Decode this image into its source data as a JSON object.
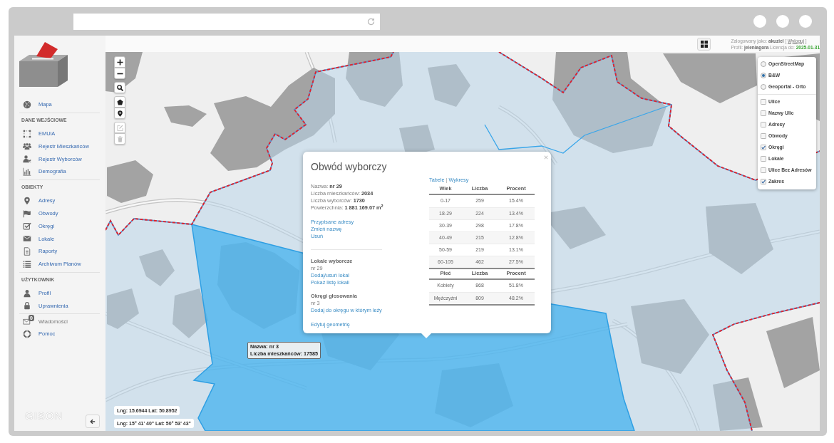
{
  "sidebar": {
    "sections": [
      {
        "items": [
          {
            "label": "Mapa",
            "disabled": false
          }
        ]
      },
      {
        "heading": "DANE WEJŚCIOWE",
        "items": [
          {
            "label": "EMUiA",
            "disabled": false
          },
          {
            "label": "Rejestr Mieszkańców",
            "disabled": false
          },
          {
            "label": "Rejestr Wyborców",
            "disabled": false
          },
          {
            "label": "Demografia",
            "disabled": false
          }
        ]
      },
      {
        "heading": "OBIEKTY",
        "items": [
          {
            "label": "Adresy",
            "disabled": false
          },
          {
            "label": "Obwody",
            "disabled": false
          },
          {
            "label": "Okręgi",
            "disabled": false
          },
          {
            "label": "Lokale",
            "disabled": false
          },
          {
            "label": "Raporty",
            "disabled": false
          },
          {
            "label": "Archiwum Planów",
            "disabled": false
          }
        ]
      },
      {
        "heading": "UŻYTKOWNIK",
        "items": [
          {
            "label": "Profil",
            "disabled": false
          },
          {
            "label": "Uprawnienia",
            "disabled": false
          }
        ]
      },
      {
        "items": [
          {
            "label": "Wiadomości",
            "disabled": true,
            "badge": "0"
          },
          {
            "label": "Pomoc",
            "disabled": false
          }
        ]
      }
    ],
    "logo": "GISON"
  },
  "header": {
    "user_line": "Zalogowany jako: **akuziel** [",
    "logout": "Wyloguj",
    "user_line_end": "]",
    "profile_line": "Profil: **jeleniagora** Licencja do:",
    "license_date": "2025-01-31"
  },
  "map": {
    "tool_groups": [
      {
        "tools": [
          {
            "disabled": false
          },
          {
            "disabled": false
          }
        ]
      },
      {
        "tools": [
          {
            "disabled": false
          }
        ]
      },
      {
        "tools": [
          {
            "disabled": false
          },
          {
            "disabled": false
          }
        ]
      },
      {
        "tools": [
          {
            "disabled": true
          },
          {
            "disabled": true
          }
        ]
      }
    ],
    "layers": {
      "base": [
        {
          "label": "OpenStreetMap",
          "selected": false
        },
        {
          "label": "B&W",
          "selected": true
        },
        {
          "label": "Geoportal - Orto",
          "selected": false
        }
      ],
      "overlays": [
        {
          "label": "Ulice",
          "checked": false
        },
        {
          "label": "Nazwy Ulic",
          "checked": false
        },
        {
          "label": "Adresy",
          "checked": false
        },
        {
          "label": "Obwody",
          "checked": false
        },
        {
          "label": "Okręgi",
          "checked": true
        },
        {
          "label": "Lokale",
          "checked": false
        },
        {
          "label": "Ulice Bez Adresów",
          "checked": false
        },
        {
          "label": "Zakres",
          "checked": true
        }
      ]
    },
    "popup": {
      "title": "Obwód wyborczy",
      "details": [
        "Nazwa: **nr 29**",
        "Liczba mieszkańców: **2034**",
        "Liczba wyborców: **1730**",
        "Powierzchnia: **1 881 169.07 m**$^{2}$"
      ],
      "actions": [
        "Przypisane adresy",
        "Zmień nazwę",
        "Usuń"
      ],
      "sections": [
        {
          "heading": "Lokale wyborcze",
          "value": "nr 29",
          "links": [
            "Dodaj/usuń lokal",
            "Pokaż listę lokali"
          ]
        },
        {
          "heading": "Okręgi głosowania",
          "value": "nr 3",
          "links": [
            "Dodaj do okręgu w którym leży"
          ]
        }
      ],
      "edit_link": "Edytuj geometrię",
      "view_links": [
        "Tabele",
        "Wykresy"
      ],
      "view_separator": "|",
      "tables": [
        {
          "columns": [
            "Wiek",
            "Liczba",
            "Procent"
          ],
          "rows": [
            [
              "0-17",
              "259",
              "15.4%"
            ],
            [
              "18-29",
              "224",
              "13.4%"
            ],
            [
              "30-39",
              "298",
              "17.8%"
            ],
            [
              "40-49",
              "215",
              "12.8%"
            ],
            [
              "50-59",
              "219",
              "13.1%"
            ],
            [
              "60-105",
              "462",
              "27.5%"
            ]
          ]
        },
        {
          "columns": [
            "Płeć",
            "Liczba",
            "Procent"
          ],
          "rows": [
            [
              "Kobiety",
              "868",
              "51.8%"
            ],
            [
              "Mężczyźni",
              "809",
              "48.2%"
            ]
          ]
        }
      ]
    },
    "tooltip": {
      "lines": [
        "Nazwa: nr 3",
        "Liczba mieszkańców: 17585"
      ]
    },
    "coordinates": [
      "Lng: 15.6944 Lat: 50.8952",
      "Lng: 15° 41' 40\" Lat: 50° 53' 43\""
    ]
  }
}
